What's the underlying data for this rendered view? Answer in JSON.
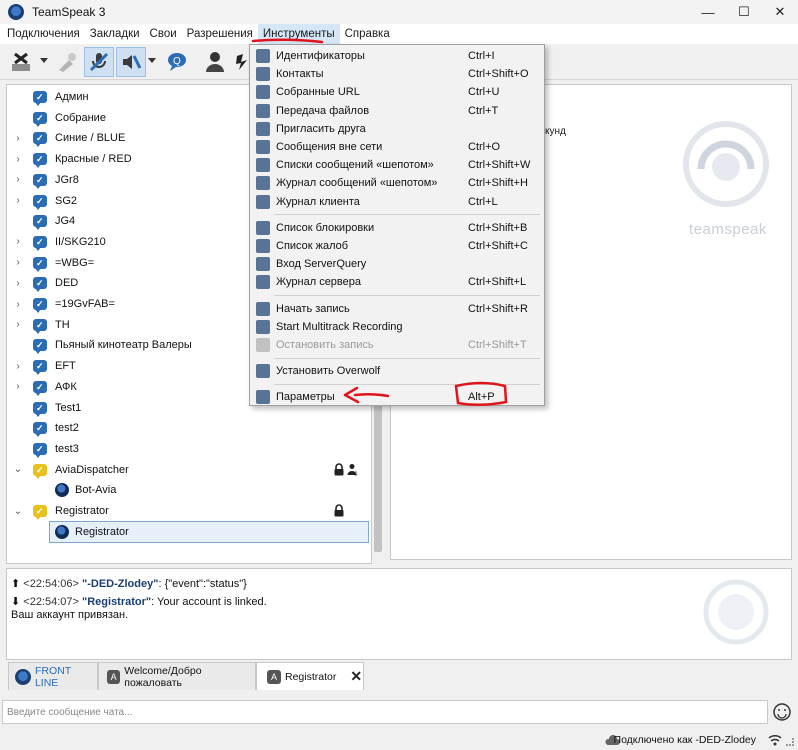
{
  "window": {
    "title": "TeamSpeak 3",
    "controls": [
      "—",
      "☐",
      "✕"
    ]
  },
  "menubar": {
    "items": [
      {
        "label": "Подключения",
        "active": false
      },
      {
        "label": "Закладки",
        "active": false
      },
      {
        "label": "Свои",
        "active": false
      },
      {
        "label": "Разрешения",
        "active": false
      },
      {
        "label": "Инструменты",
        "active": true
      },
      {
        "label": "Справка",
        "active": false
      }
    ]
  },
  "tools_menu": {
    "items": [
      {
        "label": "Идентификаторы",
        "shortcut": "Ctrl+I",
        "icon": "identities-icon",
        "disabled": false
      },
      {
        "label": "Контакты",
        "shortcut": "Ctrl+Shift+O",
        "icon": "contacts-icon",
        "disabled": false
      },
      {
        "label": "Собранные URL",
        "shortcut": "Ctrl+U",
        "icon": "url-catcher-icon",
        "disabled": false
      },
      {
        "label": "Передача файлов",
        "shortcut": "Ctrl+T",
        "icon": "file-transfer-icon",
        "disabled": false
      },
      {
        "label": "Пригласить друга",
        "shortcut": "",
        "icon": "invite-friend-icon",
        "disabled": false
      },
      {
        "label": "Сообщения вне сети",
        "shortcut": "Ctrl+O",
        "icon": "offline-messages-icon",
        "disabled": false
      },
      {
        "label": "Списки сообщений «шепотом»",
        "shortcut": "Ctrl+Shift+W",
        "icon": "whisper-lists-icon",
        "disabled": false
      },
      {
        "label": "Журнал сообщений «шепотом»",
        "shortcut": "Ctrl+Shift+H",
        "icon": "whisper-history-icon",
        "disabled": false
      },
      {
        "label": "Журнал клиента",
        "shortcut": "Ctrl+L",
        "icon": "client-log-icon",
        "disabled": false
      },
      {
        "label": "Список блокировки",
        "shortcut": "Ctrl+Shift+B",
        "icon": "ban-list-icon",
        "disabled": false
      },
      {
        "label": "Список жалоб",
        "shortcut": "Ctrl+Shift+C",
        "icon": "complaint-list-icon",
        "disabled": false
      },
      {
        "label": "Вход ServerQuery",
        "shortcut": "",
        "icon": "serverquery-login-icon",
        "disabled": false
      },
      {
        "label": "Журнал сервера",
        "shortcut": "Ctrl+Shift+L",
        "icon": "server-log-icon",
        "disabled": false
      },
      {
        "label": "Начать запись",
        "shortcut": "Ctrl+Shift+R",
        "icon": "record-icon",
        "disabled": false
      },
      {
        "label": "Start Multitrack Recording",
        "shortcut": "",
        "icon": "multitrack-record-icon",
        "disabled": false
      },
      {
        "label": "Остановить запись",
        "shortcut": "Ctrl+Shift+T",
        "icon": "stop-record-icon",
        "disabled": true
      },
      {
        "label": "Установить Overwolf",
        "shortcut": "",
        "icon": "overwolf-icon",
        "disabled": false
      },
      {
        "label": "Параметры",
        "shortcut": "Alt+P",
        "icon": "options-icon",
        "disabled": false
      }
    ]
  },
  "channel_tree": {
    "channels": [
      {
        "label": "Админ",
        "expandable": false,
        "icon": "channel-icon"
      },
      {
        "label": "Собрание",
        "expandable": false,
        "icon": "channel-icon"
      },
      {
        "label": "Синие / BLUE",
        "expandable": true,
        "icon": "channel-icon"
      },
      {
        "label": "Красные / RED",
        "expandable": true,
        "icon": "channel-icon"
      },
      {
        "label": "JGr8",
        "expandable": true,
        "icon": "channel-icon"
      },
      {
        "label": "SG2",
        "expandable": true,
        "icon": "channel-icon"
      },
      {
        "label": "JG4",
        "expandable": false,
        "icon": "channel-icon"
      },
      {
        "label": "II/SKG210",
        "expandable": true,
        "icon": "channel-icon"
      },
      {
        "label": "=WBG=",
        "expandable": true,
        "icon": "channel-icon"
      },
      {
        "label": "DED",
        "expandable": true,
        "icon": "channel-icon"
      },
      {
        "label": "=19GvFAB=",
        "expandable": true,
        "icon": "channel-icon"
      },
      {
        "label": "TH",
        "expandable": true,
        "icon": "channel-icon"
      },
      {
        "label": "Пьяный кинотеатр Валеры",
        "expandable": false,
        "icon": "channel-icon"
      },
      {
        "label": "EFT",
        "expandable": true,
        "icon": "channel-icon"
      },
      {
        "label": "АФК",
        "expandable": true,
        "icon": "channel-icon"
      },
      {
        "label": "Test1",
        "expandable": false,
        "icon": "channel-icon"
      },
      {
        "label": "test2",
        "expandable": false,
        "icon": "channel-icon"
      },
      {
        "label": "test3",
        "expandable": false,
        "icon": "channel-icon"
      },
      {
        "label": "AviaDispatcher",
        "expandable": true,
        "expanded": true,
        "icon": "locked-channel-icon",
        "flags": [
          "lock-icon",
          "codec-icon"
        ]
      },
      {
        "label": "Bot-Avia",
        "is_user": true,
        "icon": "user-icon"
      },
      {
        "label": "Registrator",
        "expandable": true,
        "expanded": true,
        "icon": "locked-channel-icon",
        "flags": [
          "lock-icon"
        ]
      },
      {
        "label": "Registrator",
        "is_user": true,
        "selected": true,
        "icon": "user-icon"
      }
    ]
  },
  "info_panel": {
    "fragment": "кунд",
    "brand": "teamspeak"
  },
  "chat_log": {
    "lines": [
      {
        "arrow": "⬆",
        "time": "<22:54:06>",
        "nick": "\"-DED-Zlodey\"",
        "text": ": {\"event\":\"status\"}"
      },
      {
        "arrow": "⬇",
        "time": "<22:54:07>",
        "nick": "\"Registrator\"",
        "text": ": Your account is linked."
      },
      {
        "arrow": "",
        "time": "",
        "nick": "",
        "text": "Ваш аккаунт привязан."
      }
    ]
  },
  "chat_tabs": [
    {
      "label": "FRONT LINE",
      "icon": "server-tab-icon",
      "closable": false,
      "active": false,
      "color": "#2c6cb5"
    },
    {
      "label": "Welcome/Добро пожаловать",
      "icon": "channel-tab-icon",
      "closable": false,
      "active": false,
      "color": "#111111"
    },
    {
      "label": "Registrator",
      "icon": "private-chat-icon",
      "closable": true,
      "active": true,
      "color": "#111111"
    }
  ],
  "chat_input": {
    "placeholder": "Введите сообщение чата..."
  },
  "status_bar": {
    "text": "Подключено как -DED-Zlodey"
  },
  "colors": {
    "accent": "#2c6cb5",
    "annotation": "#e0151b",
    "menu_highlight": "#d5e6f7"
  }
}
